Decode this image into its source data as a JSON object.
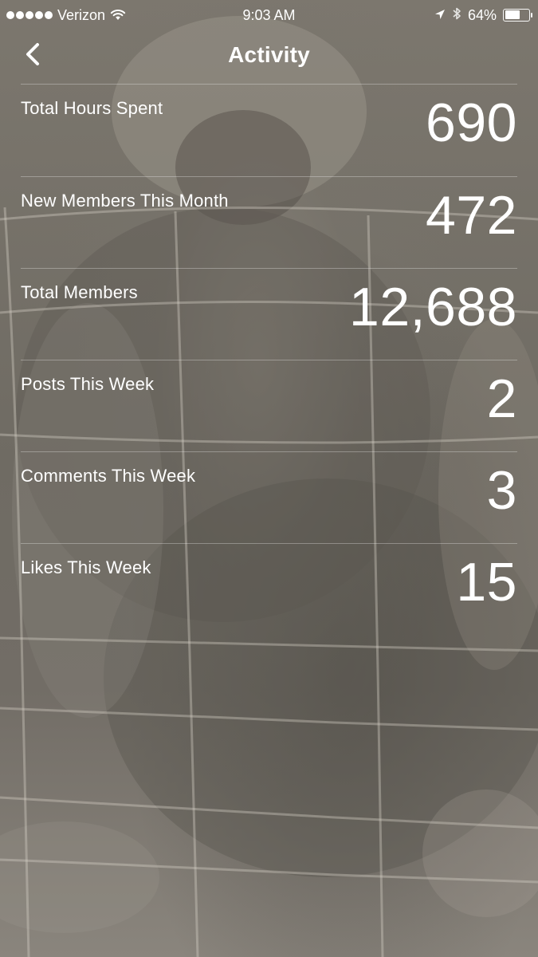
{
  "status_bar": {
    "carrier": "Verizon",
    "time": "9:03 AM",
    "battery_percent": "64%",
    "battery_level": 0.64,
    "signal_icon": "signal-dots-icon",
    "wifi_icon": "wifi-icon",
    "location_icon": "location-arrow-icon",
    "bluetooth_icon": "bluetooth-icon"
  },
  "nav": {
    "title": "Activity",
    "back_icon": "chevron-left-icon"
  },
  "stats": [
    {
      "label": "Total Hours Spent",
      "value": "690"
    },
    {
      "label": "New Members This Month",
      "value": "472"
    },
    {
      "label": "Total Members",
      "value": "12,688"
    },
    {
      "label": "Posts This Week",
      "value": "2"
    },
    {
      "label": "Comments This Week",
      "value": "3"
    },
    {
      "label": "Likes This Week",
      "value": "15"
    }
  ],
  "colors": {
    "text": "#ffffff",
    "background_tint": "#6f6a61",
    "divider": "rgba(255,255,255,0.30)"
  }
}
